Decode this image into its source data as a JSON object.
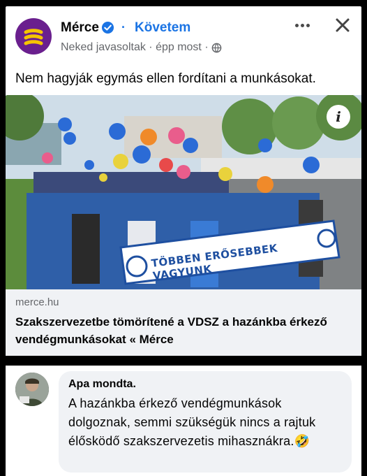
{
  "post": {
    "page_name": "Mérce",
    "follow_label": "Követem",
    "separator": "·",
    "meta_text": "Neked javasoltak · épp most ·",
    "text": "Nem hagyják egymás ellen fordítani a munkásokat.",
    "image": {
      "banner_text": "TÖBBEN ERŐSEBBEK VAGYUNK",
      "info_glyph": "i"
    },
    "link": {
      "domain": "merce.hu",
      "title": "Szakszervezetbe tömörítené a VDSZ a hazánkba érkező vendégmunkásokat « Mérce"
    },
    "icons": [
      "verified-badge-icon",
      "globe-icon",
      "more-options-icon",
      "close-icon",
      "info-icon"
    ],
    "colors": {
      "brand_purple": "#6a1f8e",
      "brand_yellow": "#f5c400",
      "link_blue": "#1b74e4"
    }
  },
  "comment": {
    "author": "Apa mondta.",
    "text": "A hazánkba érkező vendégmunkások dolgoznak, semmi szükségük nincs a rajtuk élősködő szakszervezetis mihasznákra.🤣"
  }
}
